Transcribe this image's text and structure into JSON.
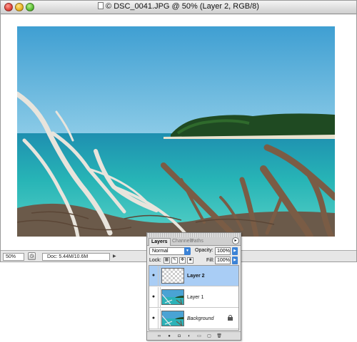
{
  "window": {
    "title": "DSC_0041.JPG @ 50% (Layer 2, RGB/8)",
    "title_prefix": "©"
  },
  "status_bar": {
    "zoom": "50%",
    "doc_size": "Doc: 5.44M/10.6M"
  },
  "layers_panel": {
    "tabs": [
      "Layers",
      "Channels",
      "Paths"
    ],
    "active_tab": "Layers",
    "blend_mode": "Normal",
    "opacity_label": "Opacity:",
    "opacity_value": "100%",
    "lock_label": "Lock:",
    "fill_label": "Fill:",
    "fill_value": "100%",
    "layers": [
      {
        "name": "Layer 2",
        "selected": true,
        "thumbnail": "transparent"
      },
      {
        "name": "Layer 1",
        "selected": false,
        "thumbnail": "photo"
      },
      {
        "name": "Background",
        "selected": false,
        "thumbnail": "photo",
        "locked": true
      }
    ],
    "footer_icons": [
      "link-icon",
      "fx-icon",
      "mask-icon",
      "adjustment-icon",
      "group-icon",
      "new-layer-icon",
      "trash-icon"
    ]
  },
  "colors": {
    "sky": "#4aa3d4",
    "sea": "#2bb2b8",
    "selection": "#a9cdf5",
    "accent": "#3b82d6"
  }
}
